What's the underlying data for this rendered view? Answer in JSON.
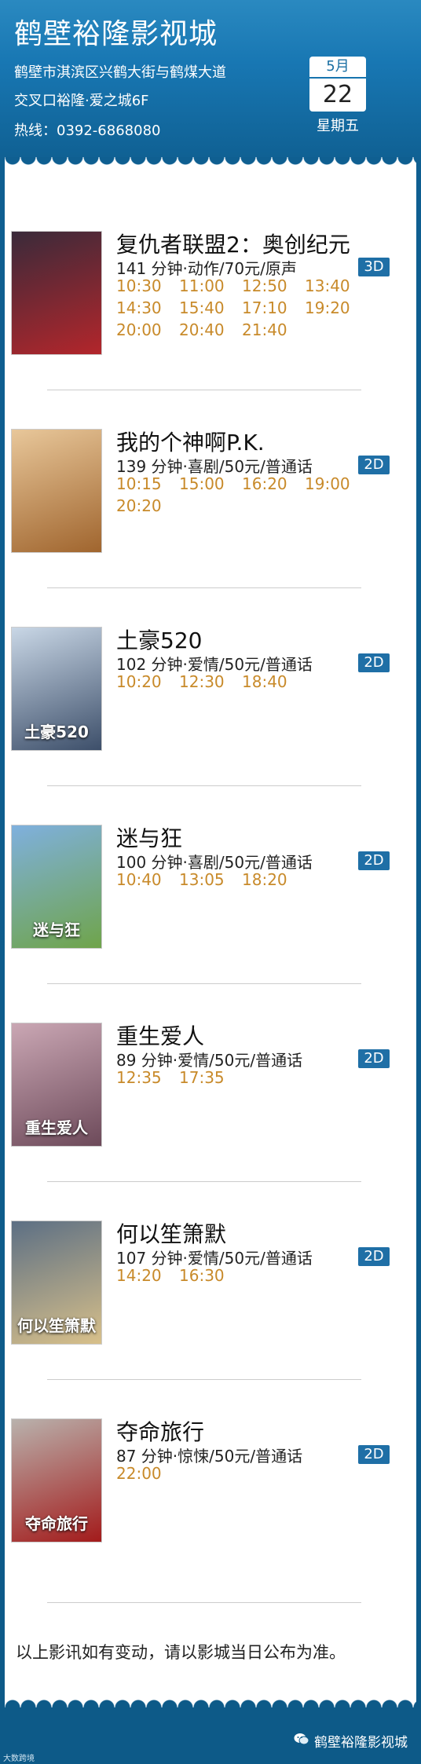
{
  "header": {
    "title": "鹤壁裕隆影视城",
    "address_line1": "鹤壁市淇滨区兴鹤大街与鹤煤大道",
    "address_line2": "交叉口裕隆·爱之城6F",
    "phone": "热线：0392-6868080"
  },
  "date": {
    "month": "5月",
    "day": "22",
    "weekday": "星期五"
  },
  "movies": [
    {
      "name": "复仇者联盟2：奥创纪元",
      "info": "141 分钟·动作/70元/原声",
      "format": "3D",
      "times": [
        "10:30",
        "11:00",
        "12:50",
        "13:40",
        "14:30",
        "15:40",
        "17:10",
        "19:20",
        "20:00",
        "20:40",
        "21:40"
      ],
      "poster_color": "#3a2a3a",
      "poster_accent": "#b3262b"
    },
    {
      "name": "我的个神啊P.K.",
      "info": "139 分钟·喜剧/50元/普通话",
      "format": "2D",
      "times": [
        "10:15",
        "15:00",
        "16:20",
        "19:00",
        "20:20"
      ],
      "poster_color": "#e8c79a",
      "poster_accent": "#a0652e"
    },
    {
      "name": "土豪520",
      "info": "102 分钟·爱情/50元/普通话",
      "format": "2D",
      "times": [
        "10:20",
        "12:30",
        "18:40"
      ],
      "poster_color": "#c9d7e6",
      "poster_accent": "#3d4f6a"
    },
    {
      "name": "迷与狂",
      "info": "100 分钟·喜剧/50元/普通话",
      "format": "2D",
      "times": [
        "10:40",
        "13:05",
        "18:20"
      ],
      "poster_color": "#7fb0de",
      "poster_accent": "#6fa44a"
    },
    {
      "name": "重生爱人",
      "info": "89 分钟·爱情/50元/普通话",
      "format": "2D",
      "times": [
        "12:35",
        "17:35"
      ],
      "poster_color": "#caa7b4",
      "poster_accent": "#6d4a5a"
    },
    {
      "name": "何以笙箫默",
      "info": "107 分钟·爱情/50元/普通话",
      "format": "2D",
      "times": [
        "14:20",
        "16:30"
      ],
      "poster_color": "#5c6f84",
      "poster_accent": "#d8c08a"
    },
    {
      "name": "夺命旅行",
      "info": "87 分钟·惊悚/50元/普通话",
      "format": "2D",
      "times": [
        "22:00"
      ],
      "poster_color": "#b9b2ad",
      "poster_accent": "#a31b1b"
    }
  ],
  "poster_texts": [
    "",
    "",
    "土豪520",
    "迷与狂",
    "重生爱人",
    "何以笙箫默",
    "夺命旅行"
  ],
  "notice": "以上影讯如有变动，请以影城当日公布为准。",
  "footer": {
    "account": "鹤壁裕隆影视城",
    "watermark": "大数跨境"
  },
  "colors": {
    "header_blue": "#1877b3",
    "time_gold": "#c88a2a",
    "badge_blue": "#1f6fa6"
  }
}
